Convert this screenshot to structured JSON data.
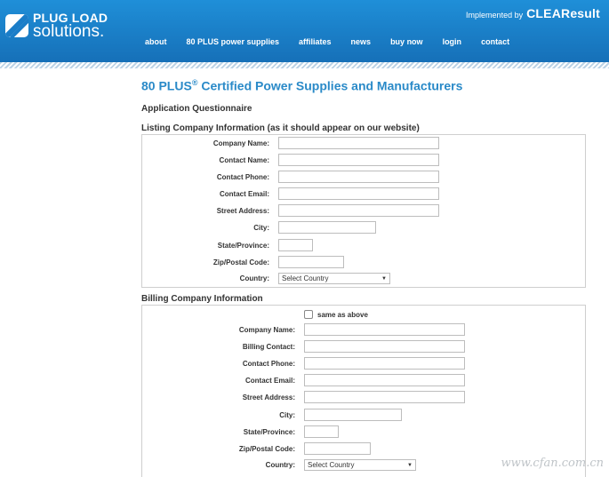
{
  "header": {
    "logo_line1": "PLUG LOAD",
    "logo_line2": "solutions",
    "logo_dot": ".",
    "implemented_by": "Implemented by",
    "brand": "CLEAResult",
    "brand_suffix": "°"
  },
  "nav": [
    "about",
    "80 PLUS power supplies",
    "affiliates",
    "news",
    "buy now",
    "login",
    "contact"
  ],
  "page": {
    "title": "80 PLUS",
    "title_sup": "®",
    "title_rest": " Certified Power Supplies and Manufacturers",
    "subtitle": "Application Questionnaire"
  },
  "listing": {
    "title": "Listing Company Information (as it should appear on our website)",
    "fields": {
      "company_name": "Company Name:",
      "contact_name": "Contact Name:",
      "contact_phone": "Contact Phone:",
      "contact_email": "Contact Email:",
      "street_address": "Street Address:",
      "city": "City:",
      "state": "State/Province:",
      "zip": "Zip/Postal Code:",
      "country": "Country:"
    },
    "country_value": "Select Country"
  },
  "billing": {
    "title": "Billing Company Information",
    "same_as_above": "same as above",
    "fields": {
      "company_name": "Company Name:",
      "billing_contact": "Billing Contact:",
      "contact_phone": "Contact Phone:",
      "contact_email": "Contact Email:",
      "street_address": "Street Address:",
      "city": "City:",
      "state": "State/Province:",
      "zip": "Zip/Postal Code:",
      "country": "Country:"
    },
    "country_value": "Select Country"
  },
  "watermark": "www.cfan.com.cn"
}
